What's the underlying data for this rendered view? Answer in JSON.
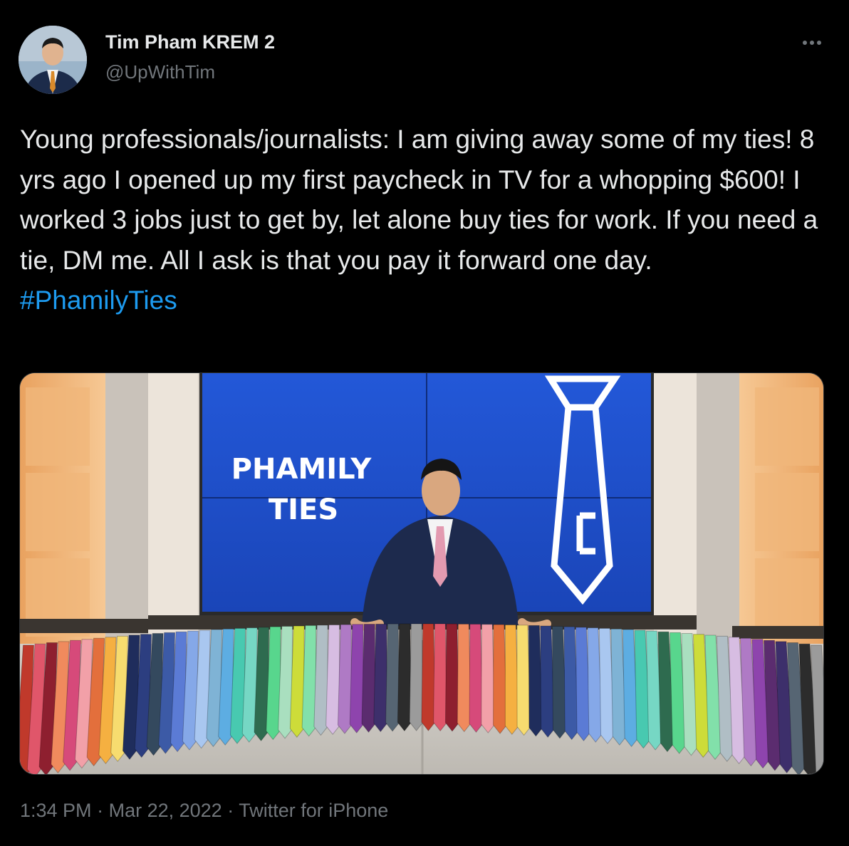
{
  "author": {
    "display_name": "Tim Pham KREM 2",
    "handle": "@UpWithTim",
    "avatar_icon": "profile-photo"
  },
  "more_icon": "more-horizontal-icon",
  "tweet": {
    "text": "Young professionals/journalists: I am giving away some of my ties! 8 yrs ago I opened up my first paycheck in TV for a whopping $600! I worked 3 jobs just to get by, let alone buy ties for work. If you need a tie, DM me. All I ask is that you pay it forward one day.",
    "hashtag": "#PhamilyTies"
  },
  "media": {
    "screen_text_line1": "PHAMILY",
    "screen_text_line2": "TIES"
  },
  "meta": {
    "time": "1:34 PM",
    "separator": "·",
    "date": "Mar 22, 2022",
    "source": "Twitter for iPhone"
  },
  "colors": {
    "background": "#000000",
    "text": "#e7e9ea",
    "secondary": "#71767b",
    "link": "#1d9bf0",
    "screen_blue": "#1f4fd0"
  }
}
